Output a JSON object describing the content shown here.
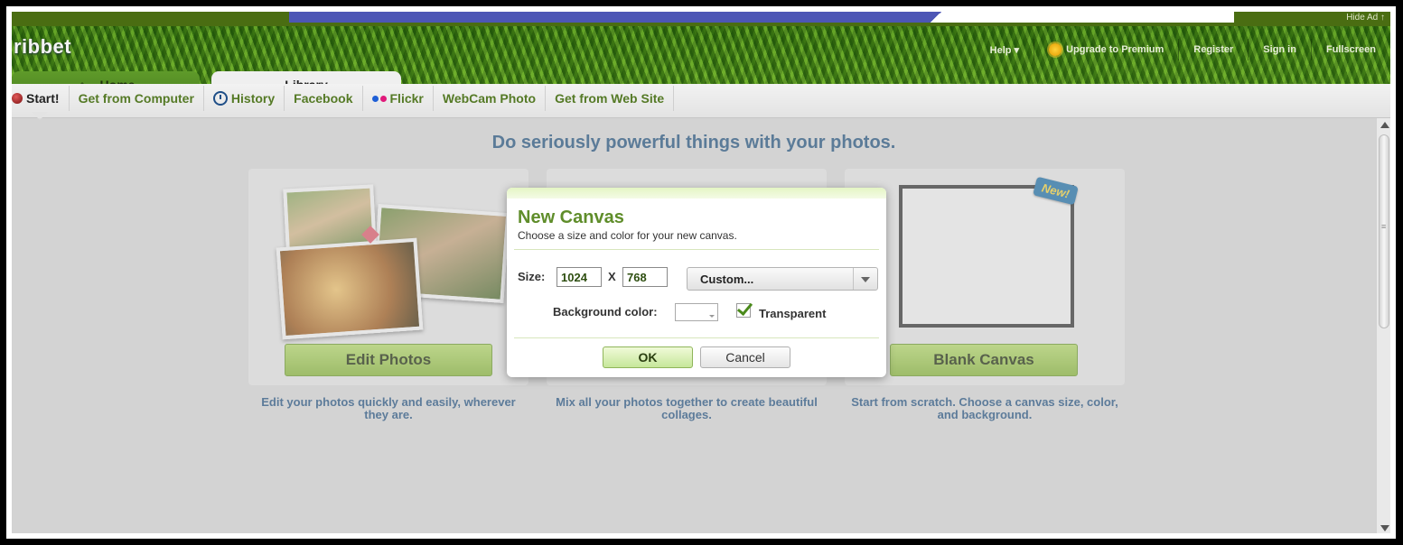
{
  "ad": {
    "hide_label": "Hide Ad ↑"
  },
  "header": {
    "logo": "ribbet",
    "nav": [
      {
        "label": "Help ▾"
      },
      {
        "label": "Upgrade to Premium",
        "icon": "sun-icon"
      },
      {
        "label": "Register"
      },
      {
        "label": "Sign in"
      },
      {
        "label": "Fullscreen"
      }
    ]
  },
  "tabs": {
    "home": "Home",
    "library": "Library"
  },
  "subnav": [
    {
      "label": "Start!",
      "icon": "red-ball-icon"
    },
    {
      "label": "Get from Computer"
    },
    {
      "label": "History",
      "icon": "clock-icon"
    },
    {
      "label": "Facebook"
    },
    {
      "label": "Flickr",
      "icon": "flickr-dots-icon"
    },
    {
      "label": "WebCam Photo"
    },
    {
      "label": "Get from Web Site"
    }
  ],
  "main": {
    "headline": "Do seriously powerful things with your photos.",
    "cards": [
      {
        "button": "Edit Photos",
        "description": "Edit your photos quickly and easily, wherever they are."
      },
      {
        "button": "",
        "description": "Mix all your photos together to create beautiful collages."
      },
      {
        "button": "Blank Canvas",
        "description": "Start from scratch. Choose a canvas size, color, and background.",
        "badge": "New!"
      }
    ]
  },
  "dialog": {
    "title": "New Canvas",
    "subtitle": "Choose a size and color for your new canvas.",
    "size_label": "Size:",
    "width": "1024",
    "x_label": "X",
    "height": "768",
    "preset": "Custom...",
    "bg_label": "Background color:",
    "transparent_label": "Transparent",
    "transparent_checked": true,
    "ok": "OK",
    "cancel": "Cancel"
  },
  "colors": {
    "accent_green": "#5f8d2a",
    "link_blue": "#21527e",
    "subnav_green": "#557a26"
  }
}
